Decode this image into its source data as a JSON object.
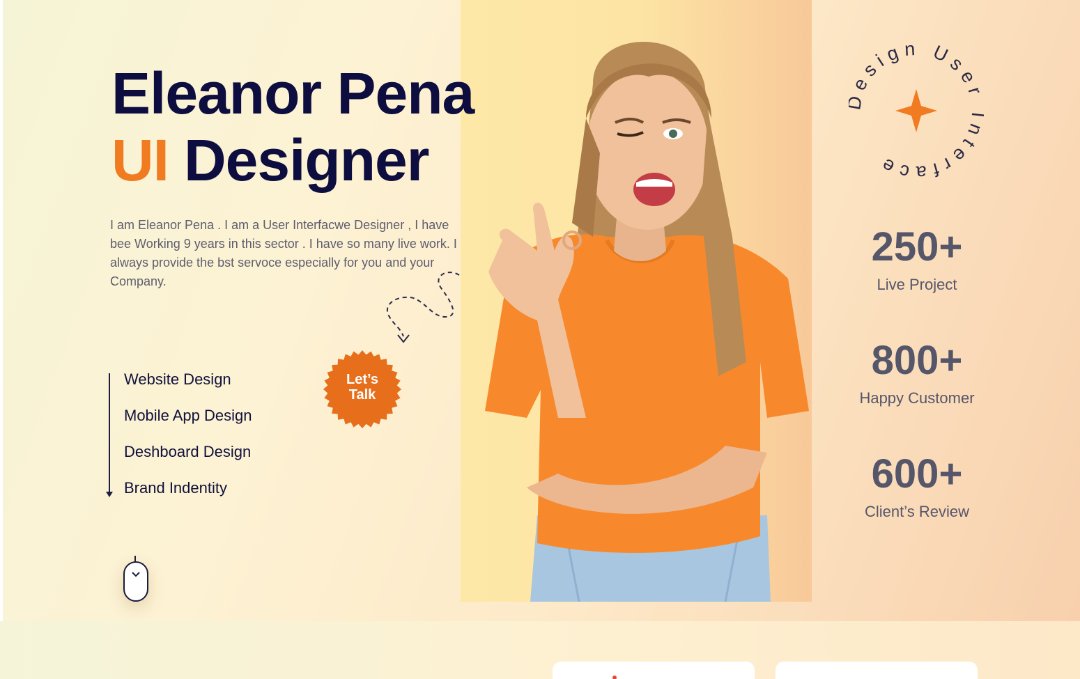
{
  "hero": {
    "name": "Eleanor Pena",
    "role_accent": "UI",
    "role_rest": "Designer",
    "intro": "I am Eleanor Pena . I am a User Interfacwe Designer , I have bee Working 9 years in this sector . I have so many live work. I always provide the bst servoce especially for you and your Company.",
    "services": [
      "Website Design",
      "Mobile App Design",
      "Deshboard Design",
      "Brand Indentity"
    ],
    "cta_label_line1": "Let’s",
    "cta_label_line2": "Talk",
    "rotating_badge_text": "Design User Interface ",
    "stats": [
      {
        "value": "250+",
        "label": "Live Project"
      },
      {
        "value": "800+",
        "label": "Happy Customer"
      },
      {
        "value": "600+",
        "label": "Client’s Review"
      }
    ]
  },
  "icons": {
    "scroll": "mouse-scroll-icon",
    "star": "four-point-star-icon",
    "arrow": "dashed-arrow-icon"
  },
  "colors": {
    "accent": "#f07b21",
    "heading": "#0d0d3f",
    "body_text": "#5d5d6e",
    "stats_text": "#55566a"
  }
}
